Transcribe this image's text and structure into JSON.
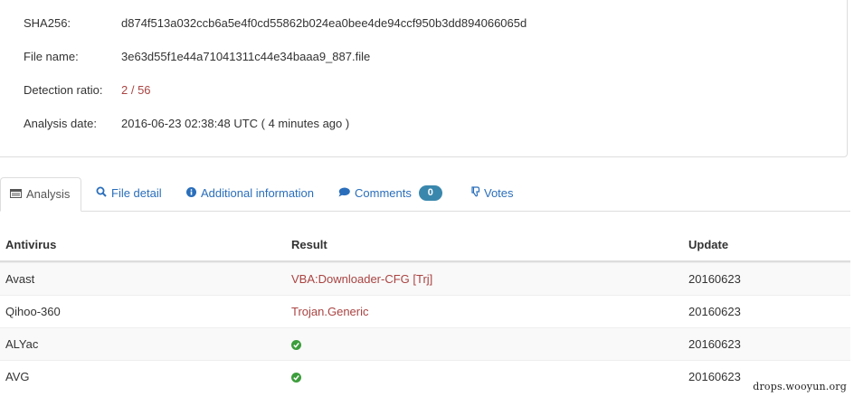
{
  "file_info": {
    "sha256": {
      "label": "SHA256:",
      "value": "d874f513a032ccb6a5e4f0cd55862b024ea0bee4de94ccf950b3dd894066065d"
    },
    "file_name": {
      "label": "File name:",
      "value": "3e63d55f1e44a71041311c44e34baaa9_887.file"
    },
    "detection_ratio": {
      "label": "Detection ratio:",
      "value": "2 / 56"
    },
    "analysis_date": {
      "label": "Analysis date:",
      "value": "2016-06-23 02:38:48 UTC ( 4 minutes ago )"
    }
  },
  "tabs": [
    {
      "label": "Analysis",
      "icon": "table-icon",
      "active": true
    },
    {
      "label": "File detail",
      "icon": "search-icon"
    },
    {
      "label": "Additional information",
      "icon": "info-icon"
    },
    {
      "label": "Comments",
      "icon": "comment-icon",
      "badge": "0"
    },
    {
      "label": "Votes",
      "icon": "thumbs-down-icon"
    }
  ],
  "table": {
    "headers": [
      "Antivirus",
      "Result",
      "Update"
    ],
    "rows": [
      {
        "antivirus": "Avast",
        "result": "VBA:Downloader-CFG [Trj]",
        "detected": true,
        "update": "20160623"
      },
      {
        "antivirus": "Qihoo-360",
        "result": "Trojan.Generic",
        "detected": true,
        "update": "20160623"
      },
      {
        "antivirus": "ALYac",
        "result": "check-icon",
        "detected": false,
        "update": "20160623"
      },
      {
        "antivirus": "AVG",
        "result": "check-icon",
        "detected": false,
        "update": "20160623"
      }
    ]
  },
  "colors": {
    "link": "#2a6ebb",
    "detected": "#a94442",
    "clean": "#3c9d3c",
    "badge": "#3a87ad"
  },
  "watermark": "drops.wooyun.org"
}
